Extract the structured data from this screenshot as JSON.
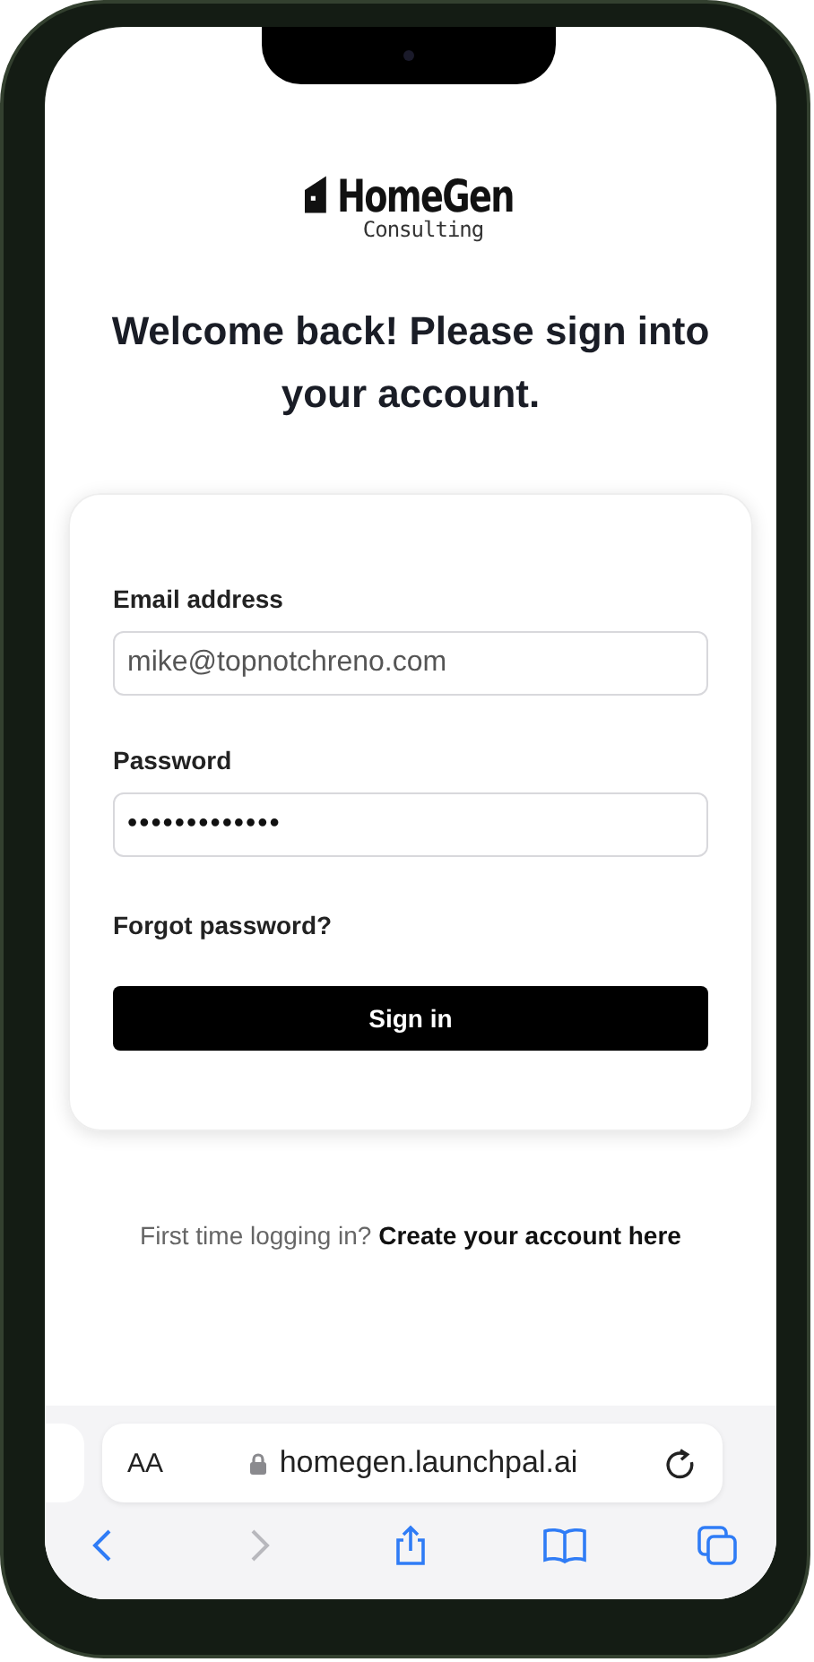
{
  "logo": {
    "name": "HomeGen",
    "tagline": "Consulting"
  },
  "heading": "Welcome back! Please sign into your account.",
  "form": {
    "fields": [
      {
        "label": "Email address",
        "value": "mike@topnotchreno.com",
        "kind": "text"
      },
      {
        "label": "Password",
        "value": "•••••••••••••",
        "kind": "password"
      }
    ],
    "forgot_link": "Forgot password?",
    "submit": "Sign in"
  },
  "footer": {
    "prompt": "First time logging in?",
    "link": "Create your account here"
  },
  "browser": {
    "text_size": "AA",
    "url": "homegen.launchpal.ai",
    "toolbar": [
      {
        "kind": "back",
        "disabled": false
      },
      {
        "kind": "forward",
        "disabled": true
      },
      {
        "kind": "share",
        "disabled": false
      },
      {
        "kind": "bookmarks",
        "disabled": false
      },
      {
        "kind": "tabs",
        "disabled": false
      }
    ]
  }
}
